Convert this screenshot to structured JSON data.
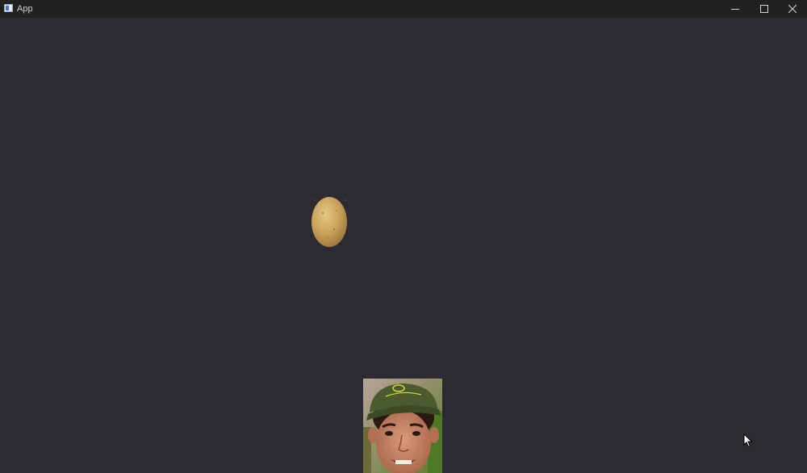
{
  "window": {
    "title": "App",
    "app_icon": "app-window-icon",
    "controls": {
      "minimize_icon": "minimize-icon",
      "maximize_icon": "maximize-icon",
      "close_icon": "close-icon"
    }
  },
  "canvas": {
    "background": "#2c2b31",
    "sprites": {
      "potato": "potato",
      "player_photo": "player-face-photo"
    }
  },
  "pointer": {
    "icon": "mouse-cursor-icon"
  }
}
